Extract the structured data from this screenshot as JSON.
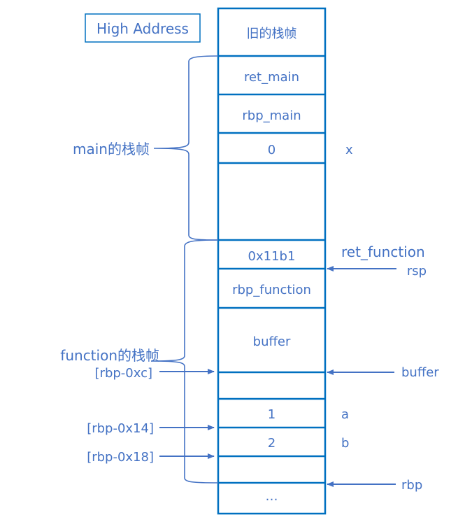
{
  "title_box": {
    "label": "High Address"
  },
  "colors": {
    "frame": "#0070c0",
    "text": "#4472c4",
    "bracket": "#4472c4"
  },
  "stack": {
    "cells": [
      {
        "label": "旧的栈帧",
        "side_label": ""
      },
      {
        "label": "ret_main",
        "side_label": ""
      },
      {
        "label": "rbp_main",
        "side_label": ""
      },
      {
        "label": "0",
        "side_label": "x"
      },
      {
        "label": "",
        "side_label": ""
      },
      {
        "label": "0x11b1",
        "side_label": "ret_function"
      },
      {
        "label": "rbp_function",
        "side_label": ""
      },
      {
        "label": "buffer",
        "side_label": ""
      },
      {
        "label": "",
        "side_label": ""
      },
      {
        "label": "1",
        "side_label": "a"
      },
      {
        "label": "2",
        "side_label": "b"
      },
      {
        "label": "",
        "side_label": ""
      },
      {
        "label": "…",
        "side_label": ""
      }
    ]
  },
  "frames": {
    "main": {
      "label": "main的栈帧"
    },
    "function": {
      "label": "function的栈帧"
    }
  },
  "right_pointers": [
    {
      "label": "rsp"
    },
    {
      "label": "buffer"
    },
    {
      "label": "rbp"
    }
  ],
  "left_pointers": [
    {
      "label": "[rbp-0xc]"
    },
    {
      "label": "[rbp-0x14]"
    },
    {
      "label": "[rbp-0x18]"
    }
  ]
}
